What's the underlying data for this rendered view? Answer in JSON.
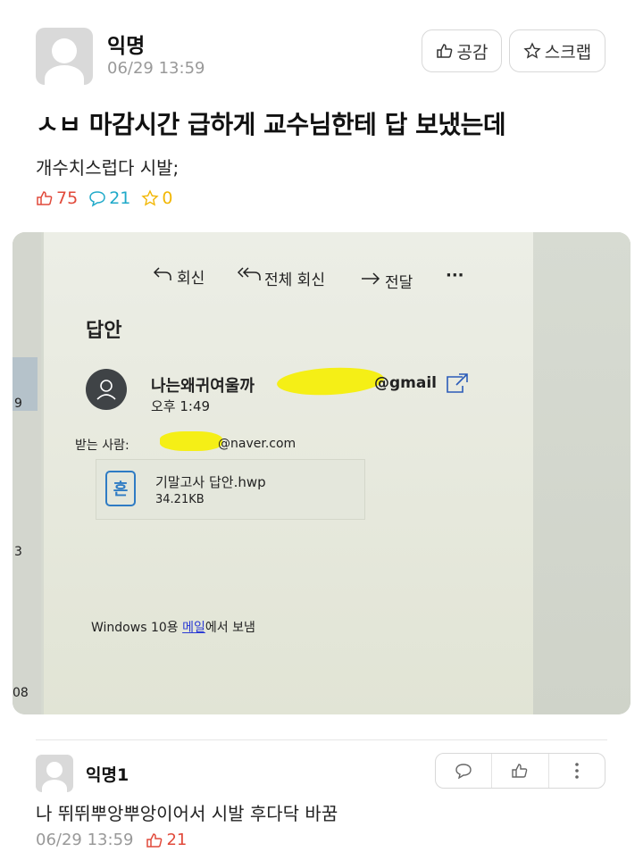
{
  "post": {
    "author": "익명",
    "timestamp": "06/29 13:59",
    "title": "ㅅㅂ 마감시간 급하게 교수님한테 답 보냈는데",
    "body": "개수치스럽다 시발;",
    "likes": "75",
    "comments": "21",
    "scraps": "0",
    "like_button": "공감",
    "scrap_button": "스크랩"
  },
  "photo": {
    "toolbar": {
      "reply": "회신",
      "reply_all": "전체 회신",
      "forward": "전달",
      "more": "···"
    },
    "subject": "답안",
    "sender_name": "나는왜귀여울까",
    "sender_email_suffix": "@gmail",
    "sent_time": "오후 1:49",
    "to_label": "받는 사람:",
    "to_email_suffix": "@naver.com",
    "attachment_name": "기말고사 답안.hwp",
    "attachment_size": "34.21KB",
    "attachment_icon_char": "흔",
    "footer_prefix": "Windows 10용 ",
    "footer_link": "메일",
    "footer_suffix": "에서 보냄",
    "left_edge_chars": [
      "9",
      "3",
      "08"
    ]
  },
  "comment": {
    "author": "익명1",
    "text": "나 뛰뛰뿌앙뿌앙이어서 시발 후다닥 바꿈",
    "timestamp": "06/29 13:59",
    "likes": "21"
  },
  "colors": {
    "like_red": "#e14a3b",
    "comment_teal": "#1fa9c9",
    "scrap_yellow": "#f2b705",
    "link_blue": "#2b3bd4",
    "highlight": "#f6f000"
  }
}
